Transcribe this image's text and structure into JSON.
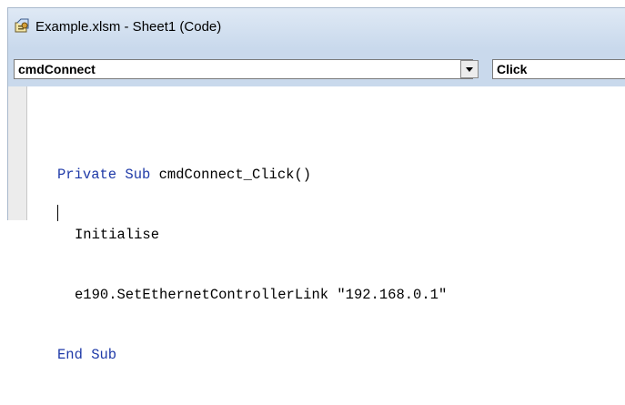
{
  "window": {
    "title": "Example.xlsm - Sheet1 (Code)",
    "icon": "vba-module-icon"
  },
  "toolbar": {
    "object_combo_value": "cmdConnect",
    "procedure_combo_value": "Click",
    "dropdown_icon": "chevron-down-icon"
  },
  "code": {
    "line1_keyword": "Private Sub",
    "line1_rest": " cmdConnect_Click()",
    "line2": "Initialise",
    "line3": "e190.SetEthernetControllerLink \"192.168.0.1\"",
    "line4_keyword": "End Sub"
  },
  "colors": {
    "keyword": "#1f3aa8",
    "titlebar": "#c9d9ec"
  }
}
